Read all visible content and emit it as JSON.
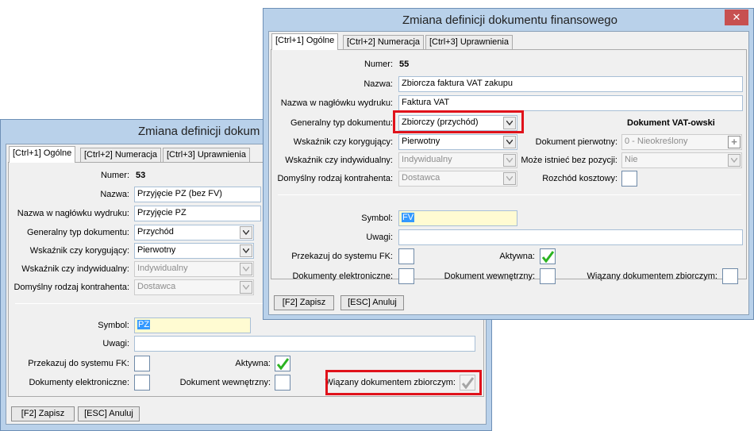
{
  "colors": {
    "window_frame": "#b9d1ea",
    "highlight_box": "#e0121b",
    "selection": "#3399ff",
    "symbol_field": "#fffbd2",
    "check_green": "#2bb321"
  },
  "back_window": {
    "title": "Zmiana definicji dokum",
    "tabs": [
      "[Ctrl+1] Ogólne",
      "[Ctrl+2] Numeracja",
      "[Ctrl+3] Uprawnienia"
    ],
    "labels": {
      "numer": "Numer:",
      "nazwa": "Nazwa:",
      "nazwa_naglowek": "Nazwa w nagłówku wydruku:",
      "generalny_typ": "Generalny typ dokumentu:",
      "wskaznik_korygujacy": "Wskaźnik czy korygujący:",
      "wskaznik_indywidualny": "Wskaźnik czy indywidualny:",
      "domyslny_kontrahent": "Domyślny rodzaj kontrahenta:",
      "symbol": "Symbol:",
      "uwagi": "Uwagi:",
      "przekazuj_fk": "Przekazuj do systemu FK:",
      "aktywna": "Aktywna:",
      "dok_elektroniczne": "Dokumenty elektroniczne:",
      "dok_wewnetrzny": "Dokument wewnętrzny:",
      "wiazany": "Wiązany dokumentem zbiorczym:"
    },
    "values": {
      "numer": "53",
      "nazwa": "Przyjęcie PZ (bez FV)",
      "nazwa_naglowek": "Przyjęcie PZ",
      "generalny_typ": "Przychód",
      "wskaznik_korygujacy": "Pierwotny",
      "wskaznik_indywidualny": "Indywidualny",
      "domyslny_kontrahent": "Dostawca",
      "symbol": "PZ",
      "uwagi": ""
    },
    "checkboxes": {
      "przekazuj_fk": false,
      "aktywna": true,
      "dok_elektroniczne": false,
      "dok_wewnetrzny": false,
      "wiazany": true
    },
    "buttons": {
      "save": "[F2] Zapisz",
      "cancel": "[ESC] Anuluj"
    }
  },
  "front_window": {
    "title": "Zmiana definicji dokumentu finansowego",
    "close_glyph": "✕",
    "tabs": [
      "[Ctrl+1] Ogólne",
      "[Ctrl+2] Numeracja",
      "[Ctrl+3] Uprawnienia"
    ],
    "section_title": "Dokument VAT-owski",
    "labels": {
      "numer": "Numer:",
      "nazwa": "Nazwa:",
      "nazwa_naglowek": "Nazwa w nagłówku wydruku:",
      "generalny_typ": "Generalny typ dokumentu:",
      "wskaznik_korygujacy": "Wskaźnik czy korygujący:",
      "wskaznik_indywidualny": "Wskaźnik czy indywidualny:",
      "domyslny_kontrahent": "Domyślny rodzaj kontrahenta:",
      "dokument_pierwotny": "Dokument pierwotny:",
      "moze_istniec": "Może istnieć bez pozycji:",
      "rozchod_kosztowy": "Rozchód kosztowy:",
      "symbol": "Symbol:",
      "uwagi": "Uwagi:",
      "przekazuj_fk": "Przekazuj do systemu FK:",
      "aktywna": "Aktywna:",
      "dok_elektroniczne": "Dokumenty elektroniczne:",
      "dok_wewnetrzny": "Dokument wewnętrzny:",
      "wiazany": "Wiązany dokumentem zbiorczym:"
    },
    "values": {
      "numer": "55",
      "nazwa": "Zbiorcza faktura VAT zakupu",
      "nazwa_naglowek": "Faktura VAT",
      "generalny_typ": "Zbiorczy (przychód)",
      "wskaznik_korygujacy": "Pierwotny",
      "wskaznik_indywidualny": "Indywidualny",
      "domyslny_kontrahent": "Dostawca",
      "dokument_pierwotny": "0 - Nieokreślony",
      "moze_istniec": "Nie",
      "symbol": "FV",
      "uwagi": ""
    },
    "checkboxes": {
      "przekazuj_fk": false,
      "aktywna": true,
      "dok_elektroniczne": false,
      "dok_wewnetrzny": false,
      "wiazany": false,
      "rozchod_kosztowy": false
    },
    "buttons": {
      "save": "[F2] Zapisz",
      "cancel": "[ESC] Anuluj"
    }
  }
}
